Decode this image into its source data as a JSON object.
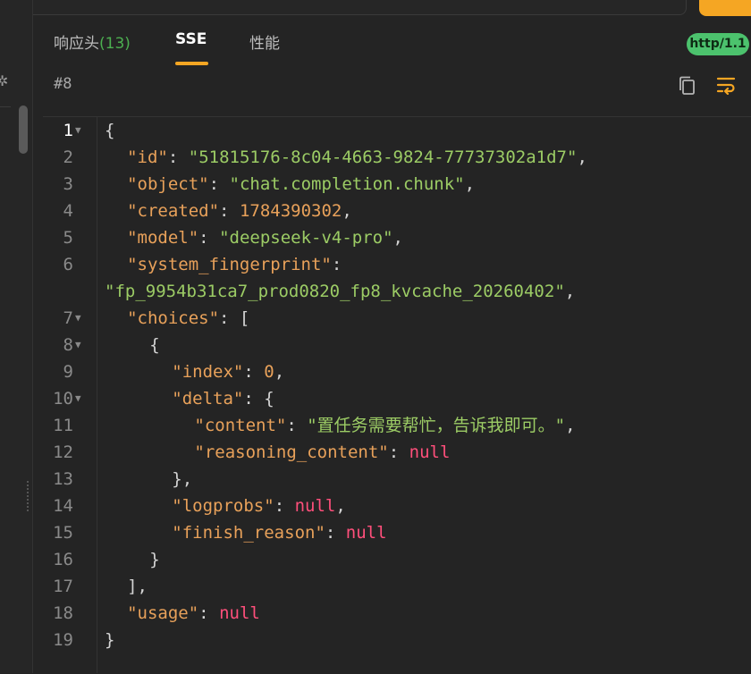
{
  "tabs": {
    "headers_label": "响应头",
    "headers_count": "(13)",
    "sse_label": "SSE",
    "perf_label": "性能"
  },
  "badge": {
    "protocol": "http/1.1"
  },
  "event": {
    "id_label": "#8"
  },
  "editor": {
    "current_line": 1,
    "lines": [
      {
        "num": "1",
        "fold": true,
        "indent": 0,
        "tokens": [
          {
            "t": "p",
            "v": "{"
          }
        ]
      },
      {
        "num": "2",
        "fold": false,
        "indent": 2,
        "tokens": [
          {
            "t": "k",
            "v": "\"id\""
          },
          {
            "t": "p",
            "v": ": "
          },
          {
            "t": "s",
            "v": "\"51815176-8c04-4663-9824-77737302a1d7\""
          },
          {
            "t": "p",
            "v": ","
          }
        ]
      },
      {
        "num": "3",
        "fold": false,
        "indent": 2,
        "tokens": [
          {
            "t": "k",
            "v": "\"object\""
          },
          {
            "t": "p",
            "v": ": "
          },
          {
            "t": "s",
            "v": "\"chat.completion.chunk\""
          },
          {
            "t": "p",
            "v": ","
          }
        ]
      },
      {
        "num": "4",
        "fold": false,
        "indent": 2,
        "tokens": [
          {
            "t": "k",
            "v": "\"created\""
          },
          {
            "t": "p",
            "v": ": "
          },
          {
            "t": "n",
            "v": "1784390302"
          },
          {
            "t": "p",
            "v": ","
          }
        ]
      },
      {
        "num": "5",
        "fold": false,
        "indent": 2,
        "tokens": [
          {
            "t": "k",
            "v": "\"model\""
          },
          {
            "t": "p",
            "v": ": "
          },
          {
            "t": "s",
            "v": "\"deepseek-v4-pro\""
          },
          {
            "t": "p",
            "v": ","
          }
        ]
      },
      {
        "num": "6",
        "fold": false,
        "indent": 2,
        "tokens": [
          {
            "t": "k",
            "v": "\"system_fingerprint\""
          },
          {
            "t": "p",
            "v": ":"
          }
        ]
      },
      {
        "num": "",
        "fold": false,
        "indent": 0,
        "tokens": [
          {
            "t": "s",
            "v": "\"fp_9954b31ca7_prod0820_fp8_kvcache_20260402\""
          },
          {
            "t": "p",
            "v": ","
          }
        ]
      },
      {
        "num": "7",
        "fold": true,
        "indent": 2,
        "tokens": [
          {
            "t": "k",
            "v": "\"choices\""
          },
          {
            "t": "p",
            "v": ": ["
          }
        ]
      },
      {
        "num": "8",
        "fold": true,
        "indent": 4,
        "tokens": [
          {
            "t": "p",
            "v": "{"
          }
        ]
      },
      {
        "num": "9",
        "fold": false,
        "indent": 6,
        "tokens": [
          {
            "t": "k",
            "v": "\"index\""
          },
          {
            "t": "p",
            "v": ": "
          },
          {
            "t": "n",
            "v": "0"
          },
          {
            "t": "p",
            "v": ","
          }
        ]
      },
      {
        "num": "10",
        "fold": true,
        "indent": 6,
        "tokens": [
          {
            "t": "k",
            "v": "\"delta\""
          },
          {
            "t": "p",
            "v": ": {"
          }
        ]
      },
      {
        "num": "11",
        "fold": false,
        "indent": 8,
        "tokens": [
          {
            "t": "k",
            "v": "\"content\""
          },
          {
            "t": "p",
            "v": ": "
          },
          {
            "t": "s",
            "v": "\"置任务需要帮忙，告诉我即可。\""
          },
          {
            "t": "p",
            "v": ","
          }
        ]
      },
      {
        "num": "12",
        "fold": false,
        "indent": 8,
        "tokens": [
          {
            "t": "k",
            "v": "\"reasoning_content\""
          },
          {
            "t": "p",
            "v": ": "
          },
          {
            "t": "nl",
            "v": "null"
          }
        ]
      },
      {
        "num": "13",
        "fold": false,
        "indent": 6,
        "tokens": [
          {
            "t": "p",
            "v": "},"
          }
        ]
      },
      {
        "num": "14",
        "fold": false,
        "indent": 6,
        "tokens": [
          {
            "t": "k",
            "v": "\"logprobs\""
          },
          {
            "t": "p",
            "v": ": "
          },
          {
            "t": "nl",
            "v": "null"
          },
          {
            "t": "p",
            "v": ","
          }
        ]
      },
      {
        "num": "15",
        "fold": false,
        "indent": 6,
        "tokens": [
          {
            "t": "k",
            "v": "\"finish_reason\""
          },
          {
            "t": "p",
            "v": ": "
          },
          {
            "t": "nl",
            "v": "null"
          }
        ]
      },
      {
        "num": "16",
        "fold": false,
        "indent": 4,
        "tokens": [
          {
            "t": "p",
            "v": "}"
          }
        ]
      },
      {
        "num": "17",
        "fold": false,
        "indent": 2,
        "tokens": [
          {
            "t": "p",
            "v": "],"
          }
        ]
      },
      {
        "num": "18",
        "fold": false,
        "indent": 2,
        "tokens": [
          {
            "t": "k",
            "v": "\"usage\""
          },
          {
            "t": "p",
            "v": ": "
          },
          {
            "t": "nl",
            "v": "null"
          }
        ]
      },
      {
        "num": "19",
        "fold": false,
        "indent": 0,
        "tokens": [
          {
            "t": "p",
            "v": "}"
          }
        ]
      }
    ]
  },
  "icons": {
    "copy": "copy-icon",
    "wrap": "word-wrap-icon",
    "settings": "gear-icon",
    "fold": "triangle-down-icon"
  },
  "colors": {
    "accent": "#f5a623",
    "badge_bg": "#4cc26d",
    "count": "#4caf50",
    "key": "#e8a15a",
    "string": "#9ccc65",
    "null": "#ff4f7b"
  }
}
